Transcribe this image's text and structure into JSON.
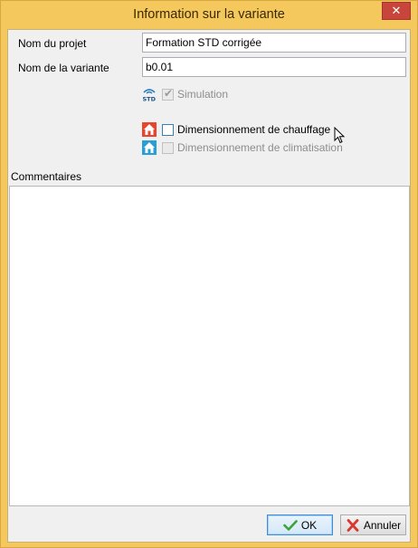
{
  "window": {
    "title": "Information sur la variante",
    "close_glyph": "✕"
  },
  "form": {
    "project_name_label": "Nom du projet",
    "project_name_value": "Formation STD corrigée",
    "variant_name_label": "Nom de la variante",
    "variant_name_value": "b0.01"
  },
  "options": {
    "simulation": {
      "label": "Simulation",
      "checked": true,
      "enabled": false,
      "icon": "std-icon"
    },
    "heating": {
      "label": "Dimensionnement de chauffage",
      "checked": false,
      "enabled": true,
      "icon": "house-heating-icon"
    },
    "cooling": {
      "label": "Dimensionnement de climatisation",
      "checked": false,
      "enabled": false,
      "icon": "house-cooling-icon"
    }
  },
  "comments": {
    "label": "Commentaires",
    "value": ""
  },
  "buttons": {
    "ok_label": "OK",
    "cancel_label": "Annuler"
  },
  "colors": {
    "title_bar": "#f5c85e",
    "close_button": "#c7453a",
    "heating_icon": "#e8452f",
    "cooling_icon": "#2a9fd6",
    "ok_check": "#3aa33a",
    "cancel_x": "#d9382f"
  }
}
